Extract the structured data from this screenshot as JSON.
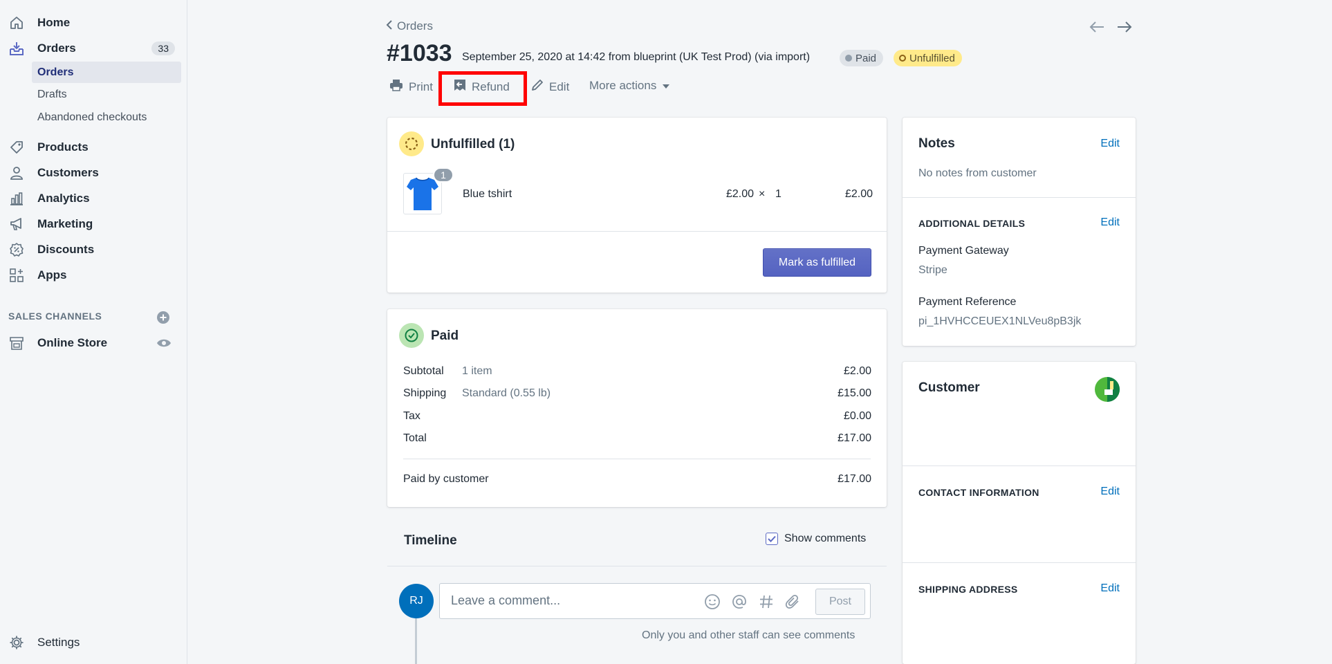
{
  "sidebar": {
    "items": [
      {
        "label": "Home",
        "icon": "home-icon"
      },
      {
        "label": "Orders",
        "icon": "orders-icon",
        "badge": "33"
      },
      {
        "label": "Products",
        "icon": "tag-icon"
      },
      {
        "label": "Customers",
        "icon": "person-icon"
      },
      {
        "label": "Analytics",
        "icon": "bar-chart-icon"
      },
      {
        "label": "Marketing",
        "icon": "megaphone-icon"
      },
      {
        "label": "Discounts",
        "icon": "discount-icon"
      },
      {
        "label": "Apps",
        "icon": "apps-icon"
      }
    ],
    "orders_sub": [
      "Orders",
      "Drafts",
      "Abandoned checkouts"
    ],
    "sales_channels_label": "SALES CHANNELS",
    "online_store": "Online Store",
    "settings": "Settings"
  },
  "header": {
    "breadcrumb": "Orders",
    "order_number": "#1033",
    "meta": "September 25, 2020 at 14:42 from blueprint (UK Test Prod) (via import)",
    "paid_badge": "Paid",
    "unfulfilled_badge": "Unfulfilled"
  },
  "actions": {
    "print": "Print",
    "refund": "Refund",
    "edit": "Edit",
    "more": "More actions"
  },
  "unfulfilled": {
    "title": "Unfulfilled (1)",
    "item_qty_badge": "1",
    "item_name": "Blue tshirt",
    "price": "£2.00",
    "times": "×",
    "qty": "1",
    "total": "£2.00",
    "button": "Mark as fulfilled"
  },
  "paid": {
    "title": "Paid",
    "rows": [
      {
        "label": "Subtotal",
        "detail": "1 item",
        "amount": "£2.00"
      },
      {
        "label": "Shipping",
        "detail": "Standard (0.55 lb)",
        "amount": "£15.00"
      },
      {
        "label": "Tax",
        "detail": "",
        "amount": "£0.00"
      },
      {
        "label": "Total",
        "detail": "",
        "amount": "£17.00"
      }
    ],
    "paid_by_label": "Paid by customer",
    "paid_by_amount": "£17.00"
  },
  "timeline": {
    "title": "Timeline",
    "show_comments": "Show comments",
    "avatar": "RJ",
    "placeholder": "Leave a comment...",
    "post": "Post",
    "note": "Only you and other staff can see comments"
  },
  "notes": {
    "title": "Notes",
    "edit": "Edit",
    "text": "No notes from customer"
  },
  "additional": {
    "title": "ADDITIONAL DETAILS",
    "edit": "Edit",
    "gateway_label": "Payment Gateway",
    "gateway_value": "Stripe",
    "reference_label": "Payment Reference",
    "reference_value": "pi_1HVHCCEUEX1NLVeu8pB3jk"
  },
  "customer": {
    "title": "Customer",
    "contact_title": "CONTACT INFORMATION",
    "contact_edit": "Edit",
    "shipping_title": "SHIPPING ADDRESS",
    "shipping_edit": "Edit"
  },
  "colors": {
    "accent": "#5c6ac4",
    "link": "#006fbb",
    "highlight": "#ff0000",
    "unfulfilled": "#ffea8a",
    "paid_green": "#50b83c"
  }
}
